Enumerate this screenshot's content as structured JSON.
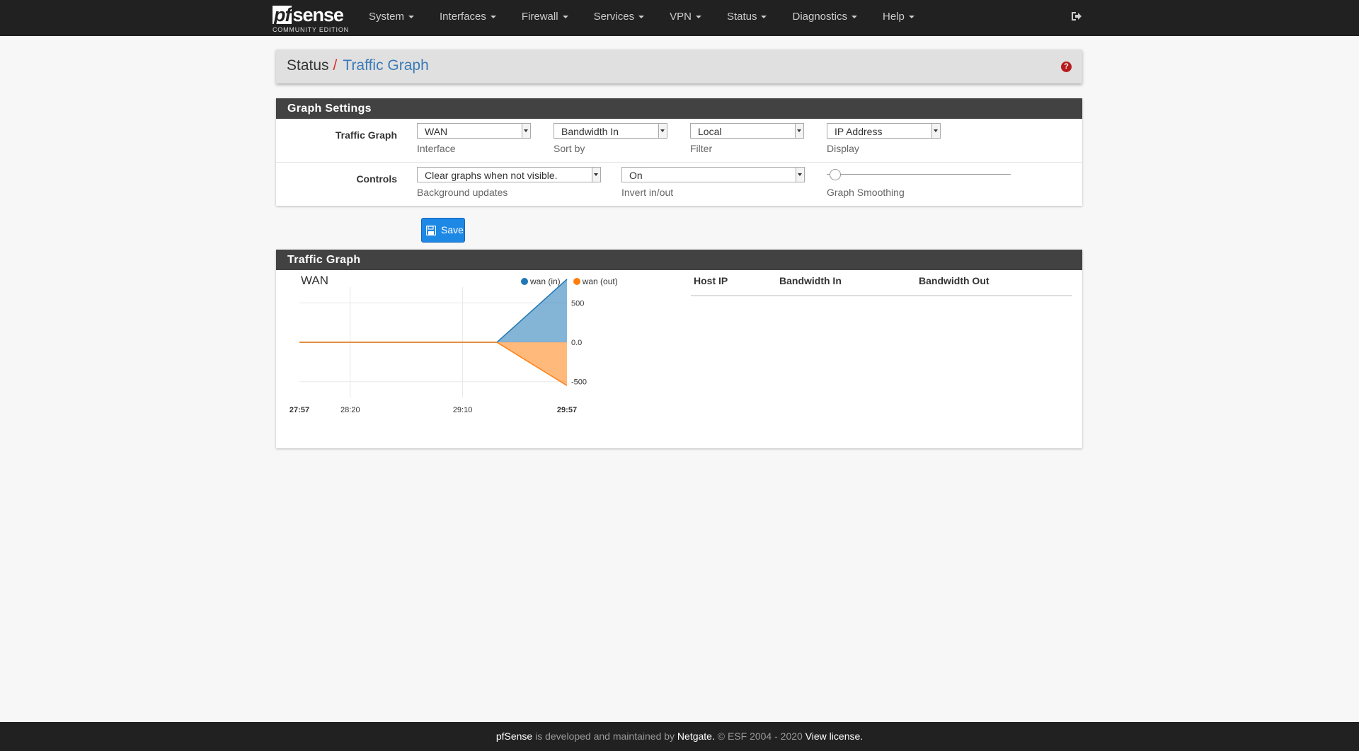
{
  "brand": {
    "pf": "pf",
    "sense": "sense",
    "edition": "COMMUNITY EDITION"
  },
  "nav": {
    "items": [
      {
        "label": "System"
      },
      {
        "label": "Interfaces"
      },
      {
        "label": "Firewall"
      },
      {
        "label": "Services"
      },
      {
        "label": "VPN"
      },
      {
        "label": "Status"
      },
      {
        "label": "Diagnostics"
      },
      {
        "label": "Help"
      }
    ],
    "logout_icon": "sign-out-icon"
  },
  "breadcrumb": {
    "section": "Status",
    "separator": "/",
    "page": "Traffic Graph",
    "help_icon": "question-circle-icon",
    "help_glyph": "?"
  },
  "settings": {
    "title": "Graph Settings",
    "row1_label": "Traffic Graph",
    "interface": {
      "value": "WAN",
      "help": "Interface"
    },
    "sort_by": {
      "value": "Bandwidth In",
      "help": "Sort by"
    },
    "filter": {
      "value": "Local",
      "help": "Filter"
    },
    "display": {
      "value": "IP Address",
      "help": "Display"
    },
    "row2_label": "Controls",
    "background_updates": {
      "value": "Clear graphs when not visible.",
      "help": "Background updates"
    },
    "invert": {
      "value": "On",
      "help": "Invert in/out"
    },
    "smoothing": {
      "help": "Graph Smoothing",
      "level": 0
    },
    "save_label": "Save"
  },
  "graph_panel": {
    "title": "Traffic Graph",
    "hosts_table": {
      "headers": [
        "Host IP",
        "Bandwidth In",
        "Bandwidth Out"
      ],
      "rows": []
    }
  },
  "chart_data": {
    "type": "area",
    "title": "WAN",
    "x_ticks": [
      "27:57",
      "28:20",
      "29:10",
      "29:57"
    ],
    "y_ticks": [
      "500",
      "0.0",
      "-500"
    ],
    "ylim": [
      -700,
      700
    ],
    "grid": true,
    "legend_position": "top",
    "series": [
      {
        "name": "wan (in)",
        "color": "#1f77b4",
        "values": [
          0,
          0,
          0,
          0,
          800
        ]
      },
      {
        "name": "wan (out)",
        "color": "#ff7f0e",
        "values": [
          0,
          0,
          0,
          0,
          -550
        ]
      }
    ]
  },
  "footer": {
    "brand": "pfSense",
    "text1": " is developed and maintained by ",
    "company": "Netgate.",
    "text2": " © ESF 2004 - 2020 ",
    "license": "View license."
  }
}
